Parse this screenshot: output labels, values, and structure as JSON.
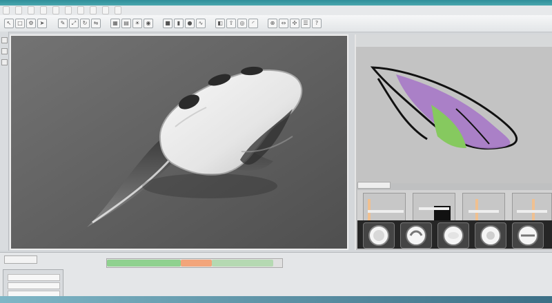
{
  "colors": {
    "accent": "#3a9aa6",
    "viewport_bg": "#6b6b6b",
    "side_bg": "#bfc0c1",
    "sketch_purple": "#a779c8",
    "sketch_green": "#86c95f",
    "timeline_green": "#8fd18f",
    "timeline_orange": "#f2a57b",
    "dark_row": "#262626"
  },
  "menu": {
    "items": [
      "",
      "",
      "",
      "",
      "",
      "",
      "",
      "",
      "",
      ""
    ]
  },
  "toolbar": {
    "icons": [
      "cursor-icon",
      "square-icon",
      "gear-icon",
      "arrow-icon",
      "pen-icon",
      "scale-icon",
      "rotate-icon",
      "mirror-icon",
      "grid-icon",
      "layer-icon",
      "light-icon",
      "camera-icon",
      "box-icon",
      "cylinder-icon",
      "sphere-icon",
      "curve-icon",
      "surface-icon",
      "extrude-icon",
      "shell-icon",
      "fillet-icon",
      "boolean-icon",
      "measure-icon",
      "snap-icon",
      "settings-icon",
      "help-icon"
    ]
  },
  "viewport": {
    "object": "computer-mouse-3d-model"
  },
  "side_panel": {
    "sketch": "leaf-shaped-curve-sketch",
    "thumbs": 5,
    "icons": [
      "wheel-1-icon",
      "wheel-2-icon",
      "wheel-3-icon",
      "wheel-4-icon",
      "wheel-5-icon"
    ]
  },
  "bottom": {
    "timeline_segments": [
      {
        "color": "#8fd18f",
        "from": 0,
        "to": 0.42
      },
      {
        "color": "#f2a57b",
        "from": 0.42,
        "to": 0.6
      },
      {
        "color": "#b5d9b2",
        "from": 0.6,
        "to": 0.95
      }
    ]
  }
}
